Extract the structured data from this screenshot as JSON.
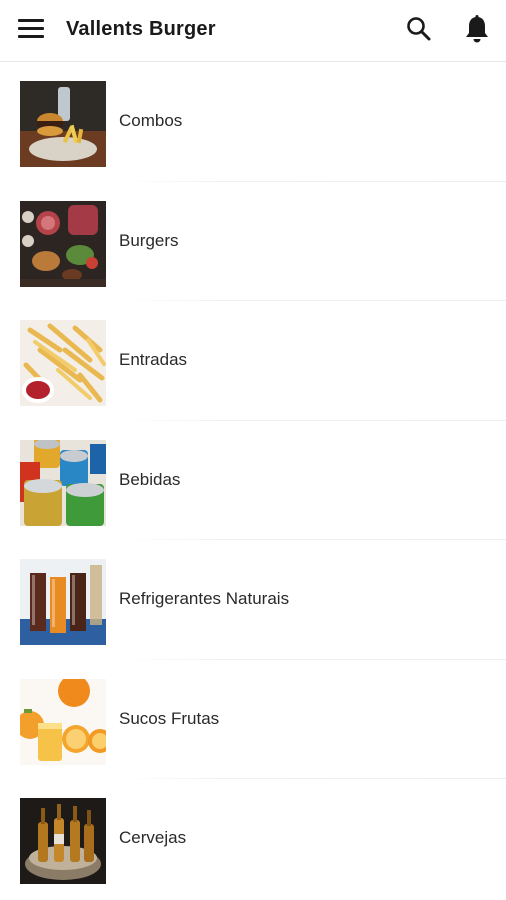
{
  "appbar": {
    "title": "Vallents Burger",
    "menu_icon": "menu-icon",
    "search_icon": "search-icon",
    "notifications_icon": "bell-icon"
  },
  "categories": [
    {
      "label": "Combos",
      "image": "combo-burger-photo"
    },
    {
      "label": "Burgers",
      "image": "burgers-photo"
    },
    {
      "label": "Entradas",
      "image": "fries-photo"
    },
    {
      "label": "Bebidas",
      "image": "cans-photo"
    },
    {
      "label": "Refrigerantes Naturais",
      "image": "soda-glasses-photo"
    },
    {
      "label": "Sucos Frutas",
      "image": "orange-juice-photo"
    },
    {
      "label": "Cervejas",
      "image": "beer-bottles-photo"
    }
  ]
}
